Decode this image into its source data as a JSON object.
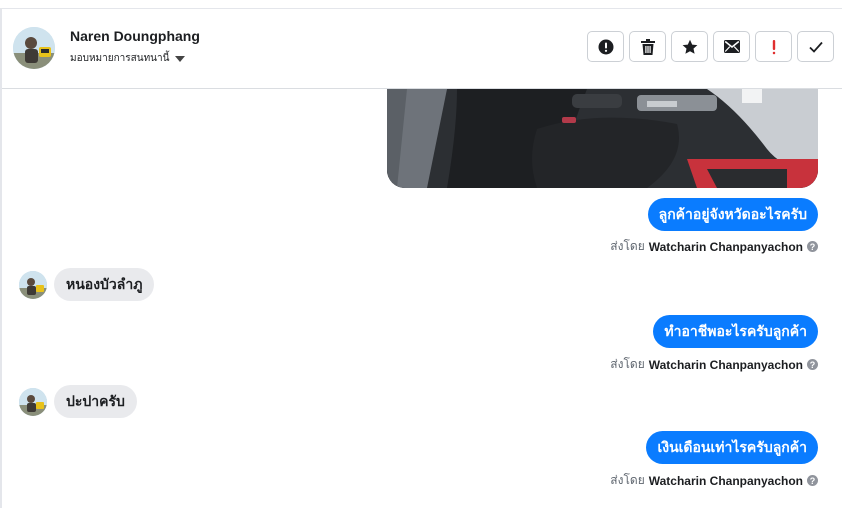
{
  "header": {
    "contact_name": "Naren Doungphang",
    "assign_label": "มอบหมายการสนทนานี้"
  },
  "actions": [
    {
      "icon": "alert-circle-icon",
      "color": "#1c1e21"
    },
    {
      "icon": "trash-icon",
      "color": "#1c1e21"
    },
    {
      "icon": "star-icon",
      "color": "#1c1e21"
    },
    {
      "icon": "envelope-icon",
      "color": "#1c1e21"
    },
    {
      "icon": "exclamation-icon",
      "color": "#e02f2f",
      "glyph": "!"
    },
    {
      "icon": "checkmark-icon",
      "color": "#1c1e21"
    }
  ],
  "messages": [
    {
      "direction": "outgoing",
      "type": "image",
      "description_icon": "car-interior-photo"
    },
    {
      "direction": "outgoing",
      "text": "ลูกค้าอยู่จังหวัดอะไรครับ"
    },
    {
      "direction": "incoming",
      "text": "หนองบัวลำภู"
    },
    {
      "direction": "outgoing",
      "text": "ทำอาชีพอะไรครับลูกค้า"
    },
    {
      "direction": "incoming",
      "text": "ปะปาครับ"
    },
    {
      "direction": "outgoing",
      "text": "เงินเดือนเท่าไรครับลูกค้า"
    }
  ],
  "sent_by": {
    "prefix": "ส่งโดย",
    "agent": "Watcharin Chanpanyachon",
    "help_glyph": "?"
  },
  "colors": {
    "outgoing_bubble": "#0a7cff",
    "incoming_bubble": "#e9eaed",
    "accent_red": "#e02f2f"
  }
}
